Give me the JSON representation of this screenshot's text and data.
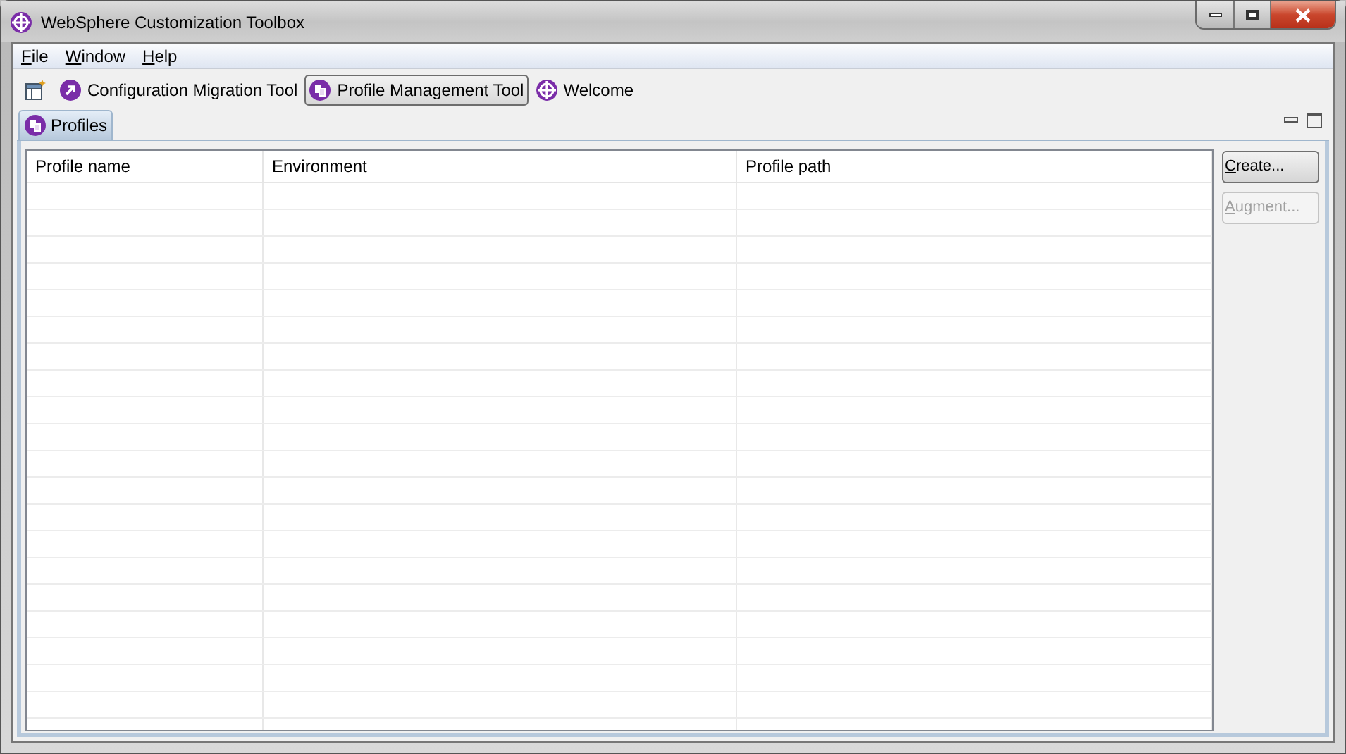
{
  "window": {
    "title": "WebSphere Customization Toolbox"
  },
  "menu": [
    {
      "label": "File"
    },
    {
      "label": "Window"
    },
    {
      "label": "Help"
    }
  ],
  "toolbar": [
    {
      "label": "Configuration Migration Tool",
      "kind": "migration",
      "selected": false
    },
    {
      "label": "Profile Management Tool",
      "kind": "profile",
      "selected": true
    },
    {
      "label": "Welcome",
      "kind": "welcome",
      "selected": false
    }
  ],
  "view_tab": {
    "label": "Profiles",
    "selected": true
  },
  "table": {
    "columns": [
      "Profile name",
      "Environment",
      "Profile path"
    ]
  },
  "buttons": [
    {
      "label": "Create...",
      "disabled": false
    },
    {
      "label": "Augment...",
      "disabled": true
    }
  ]
}
